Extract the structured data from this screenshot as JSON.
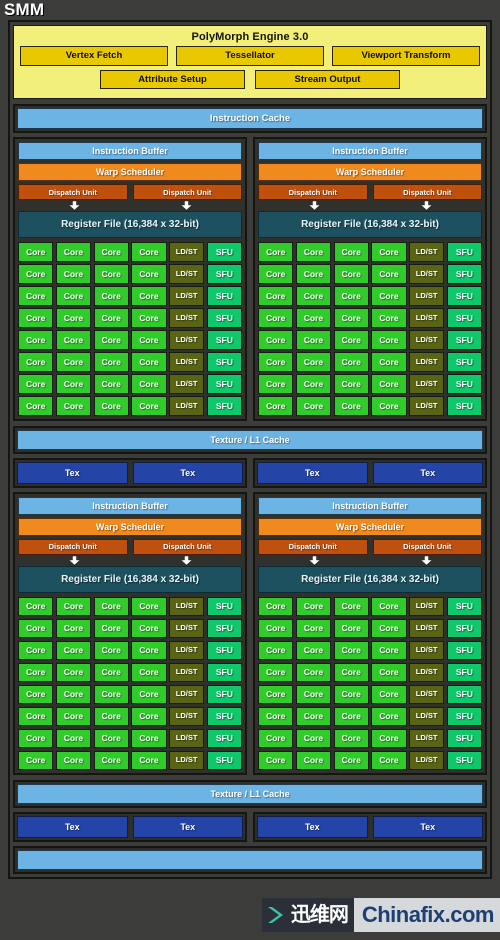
{
  "title": "SMM",
  "polymorph": {
    "title": "PolyMorph Engine 3.0",
    "row1": [
      "Vertex Fetch",
      "Tessellator",
      "Viewport Transform"
    ],
    "row2": [
      "Attribute Setup",
      "Stream Output"
    ]
  },
  "instruction_cache": "Instruction Cache",
  "processing_block": {
    "instruction_buffer": "Instruction Buffer",
    "warp_scheduler": "Warp Scheduler",
    "dispatch_units": [
      "Dispatch Unit",
      "Dispatch Unit"
    ],
    "register_file": "Register File (16,384 x 32-bit)",
    "row_units": [
      "Core",
      "Core",
      "Core",
      "Core",
      "LD/ST",
      "SFU"
    ],
    "rows": 8
  },
  "texture_cache": "Texture / L1 Cache",
  "tex_labels": [
    "Tex",
    "Tex",
    "Tex",
    "Tex"
  ],
  "shared_memory": "",
  "watermark": {
    "cn": "迅维网",
    "en": "Chinafix.com",
    "chevron": "chevron-right-icon"
  },
  "colors": {
    "background": "#3c3c3a",
    "frame_border": "#15160f",
    "polymorph_bg": "#f2f07a",
    "polymorph_box": "#e8c800",
    "cache_blue": "#6cb4e4",
    "warp_orange": "#f08a1e",
    "dispatch_orange": "#c0500d",
    "register_teal": "#1d5160",
    "core_green": "#2fcc2a",
    "ldst_olive": "#5a6414",
    "sfu_green": "#0ec86a",
    "tex_blue": "#2444a8",
    "watermark_dark": "#2b3038",
    "watermark_light": "#d6d9dc",
    "watermark_accent": "#3fc2a8"
  }
}
